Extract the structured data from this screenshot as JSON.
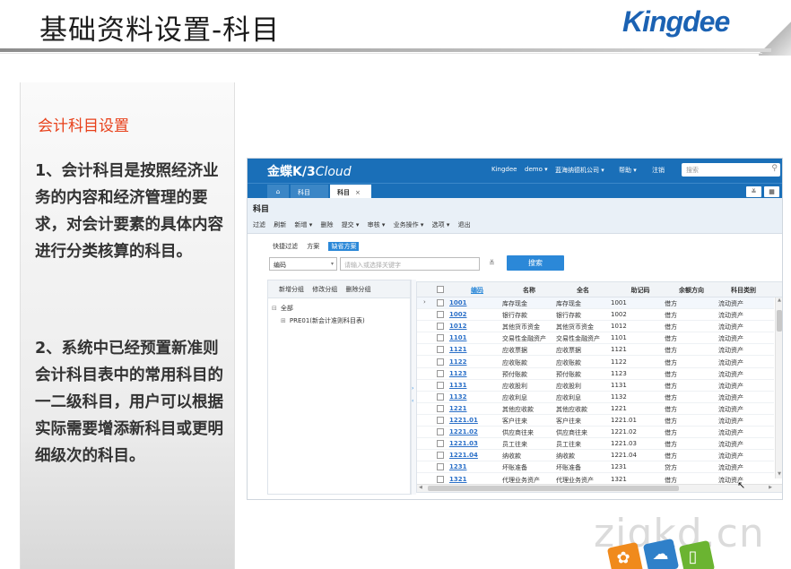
{
  "slide": {
    "title": "基础资料设置-科目",
    "logo": "Kingdee",
    "left_heading": "会计科目设置",
    "para1": " 1、会计科目是按照经济业务的内容和经济管理的要求，对会计要素的具体内容进行分类核算的科目。",
    "para2": "2、系统中已经预置新准则会计科目表中的常用科目的一二级科目，用户可以根据实际需要增添新科目或更明细级次的科目。",
    "watermark": "ziqkd.cn"
  },
  "app": {
    "brand_main": "金蝶K/3",
    "brand_cloud": "Cloud",
    "topnav": [
      "Kingdee",
      "demo ▾",
      "蓝海纳德机公司 ▾",
      "帮助 ▾",
      "注销"
    ],
    "search_placeholder": "搜索",
    "tabs": {
      "home": "⌂",
      "dark": "科目",
      "active": "科目",
      "close": "×"
    },
    "tabbar_right": [
      "≚",
      "▦"
    ],
    "page_name": "科目",
    "toolbar": [
      "过滤",
      "刷新",
      "新增 ▾",
      "删除",
      "提交 ▾",
      "审核 ▾",
      "业务操作 ▾",
      "选项 ▾",
      "退出"
    ],
    "filter_tabs": [
      "快捷过滤",
      "方案",
      "缺省方案"
    ],
    "filter_field": "编码",
    "keyword_placeholder": "请输入或选择关键字",
    "more": "≚",
    "search_button": "搜索",
    "tree_toolbar": [
      "新增分组",
      "修改分组",
      "删除分组"
    ],
    "tree": [
      {
        "exp": "⊟",
        "label": "全部"
      },
      {
        "exp": "⊞",
        "label": "PRE01(新会计准则科目表)"
      }
    ],
    "grid_headers": [
      "编码",
      "名称",
      "全名",
      "助记码",
      "余额方向",
      "科目类别"
    ],
    "rows": [
      [
        "1001",
        "库存现金",
        "库存现金",
        "1001",
        "借方",
        "流动资产"
      ],
      [
        "1002",
        "银行存款",
        "银行存款",
        "1002",
        "借方",
        "流动资产"
      ],
      [
        "1012",
        "其他货币资金",
        "其他货币资金",
        "1012",
        "借方",
        "流动资产"
      ],
      [
        "1101",
        "交易性金融资产",
        "交易性金融资产",
        "1101",
        "借方",
        "流动资产"
      ],
      [
        "1121",
        "应收票据",
        "应收票据",
        "1121",
        "借方",
        "流动资产"
      ],
      [
        "1122",
        "应收账款",
        "应收账款",
        "1122",
        "借方",
        "流动资产"
      ],
      [
        "1123",
        "预付账款",
        "预付账款",
        "1123",
        "借方",
        "流动资产"
      ],
      [
        "1131",
        "应收股利",
        "应收股利",
        "1131",
        "借方",
        "流动资产"
      ],
      [
        "1132",
        "应收利息",
        "应收利息",
        "1132",
        "借方",
        "流动资产"
      ],
      [
        "1221",
        "其他应收款",
        "其他应收款",
        "1221",
        "借方",
        "流动资产"
      ],
      [
        "1221.01",
        "客户往来",
        "客户往来",
        "1221.01",
        "借方",
        "流动资产"
      ],
      [
        "1221.02",
        "供应商往来",
        "供应商往来",
        "1221.02",
        "借方",
        "流动资产"
      ],
      [
        "1221.03",
        "员工往来",
        "员工往来",
        "1221.03",
        "借方",
        "流动资产"
      ],
      [
        "1221.04",
        "纳收款",
        "纳收款",
        "1221.04",
        "借方",
        "流动资产"
      ],
      [
        "1231",
        "坏账准备",
        "坏账准备",
        "1231",
        "贷方",
        "流动资产"
      ],
      [
        "1321",
        "代理业务资产",
        "代理业务资产",
        "1321",
        "借方",
        "流动资产"
      ]
    ]
  }
}
